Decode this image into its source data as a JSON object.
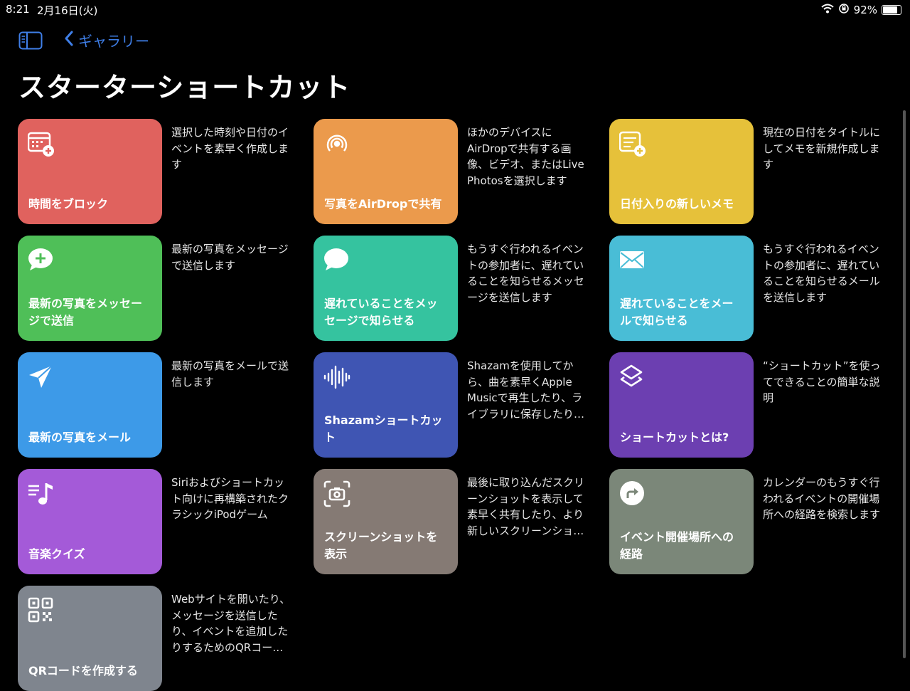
{
  "status_bar": {
    "time": "8:21",
    "date": "2月16日(火)",
    "battery": "92%",
    "battery_level": 0.92
  },
  "nav": {
    "back_label": "ギャラリー"
  },
  "page_title": "スターターショートカット",
  "shortcuts": [
    {
      "name": "時間をブロック",
      "description": "選択した時刻や日付のイベントを素早く作成します",
      "color": "#e0625e",
      "icon": "calendar-add-icon"
    },
    {
      "name": "写真をAirDropで共有",
      "description": "ほかのデバイスにAirDropで共有する画像、ビデオ、またはLive Photosを選択します",
      "color": "#eb9a4c",
      "icon": "airdrop-icon"
    },
    {
      "name": "日付入りの新しいメモ",
      "description": "現在の日付をタイトルにしてメモを新規作成します",
      "color": "#e6c13a",
      "icon": "note-add-icon"
    },
    {
      "name": "最新の写真をメッセージで送信",
      "description": "最新の写真をメッセージで送信します",
      "color": "#4fbf58",
      "icon": "message-add-icon"
    },
    {
      "name": "遅れていることをメッセージで知らせる",
      "description": "もうすぐ行われるイベントの参加者に、遅れていることを知らせるメッセージを送信します",
      "color": "#35c39f",
      "icon": "speech-bubble-icon"
    },
    {
      "name": "遅れていることをメールで知らせる",
      "description": "もうすぐ行われるイベントの参加者に、遅れていることを知らせるメールを送信します",
      "color": "#49bdd6",
      "icon": "envelope-icon"
    },
    {
      "name": "最新の写真をメール",
      "description": "最新の写真をメールで送信します",
      "color": "#3d9ae8",
      "icon": "paper-plane-icon"
    },
    {
      "name": "Shazamショートカット",
      "description": "Shazamを使用してから、曲を素早くApple Musicで再生したり、ライブラリに保存したり…",
      "color": "#3f55b3",
      "icon": "waveform-icon"
    },
    {
      "name": "ショートカットとは?",
      "description": "“ショートカット”を使ってできることの簡単な説明",
      "color": "#6c3fb1",
      "icon": "shortcuts-layers-icon"
    },
    {
      "name": "音楽クイズ",
      "description": "Siriおよびショートカット向けに再構築されたクラシックiPodゲーム",
      "color": "#a45ad8",
      "icon": "music-list-icon"
    },
    {
      "name": "スクリーンショットを表示",
      "description": "最後に取り込んだスクリーンショットを表示して素早く共有したり、より新しいスクリーンショ…",
      "color": "#857a74",
      "icon": "screenshot-camera-icon"
    },
    {
      "name": "イベント開催場所への経路",
      "description": "カレンダーのもうすぐ行われるイベントの開催場所への経路を検索します",
      "color": "#7b8779",
      "icon": "directions-arrow-icon"
    },
    {
      "name": "QRコードを作成する",
      "description": "Webサイトを開いたり、メッセージを送信したり、イベントを追加したりするためのQRコー…",
      "color": "#7f858e",
      "icon": "qr-code-icon"
    }
  ]
}
